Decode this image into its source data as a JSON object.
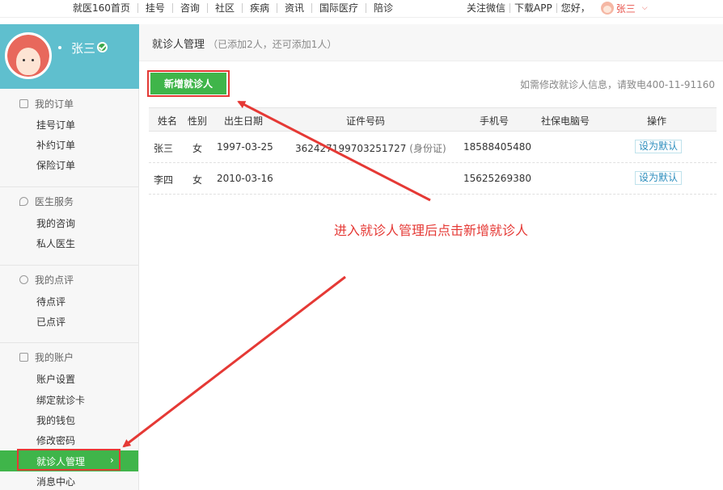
{
  "topnav": {
    "left_items": [
      "就医160首页",
      "挂号",
      "咨询",
      "社区",
      "疾病",
      "资讯",
      "国际医疗",
      "陪诊"
    ],
    "right_items": [
      "关注微信",
      "下载APP",
      "您好，"
    ],
    "user_name": "张三"
  },
  "sidebar": {
    "profile_name": "张三",
    "groups": [
      {
        "title": "我的订单",
        "links": [
          "挂号订单",
          "补约订单",
          "保险订单"
        ]
      },
      {
        "title": "医生服务",
        "links": [
          "我的咨询",
          "私人医生"
        ]
      },
      {
        "title": "我的点评",
        "links": [
          "待点评",
          "已点评"
        ]
      },
      {
        "title": "我的账户",
        "links": [
          "账户设置",
          "绑定就诊卡",
          "我的钱包",
          "修改密码"
        ]
      }
    ],
    "active_item": "就诊人管理",
    "below_active": "消息中心"
  },
  "main": {
    "title": "就诊人管理",
    "subtitle": "（已添加2人，还可添加1人）",
    "add_button": "新增就诊人",
    "hotline": "如需修改就诊人信息，请致电400-11-91160",
    "table": {
      "headers": [
        "姓名",
        "性别",
        "出生日期",
        "证件号码",
        "手机号",
        "社保电脑号",
        "操作"
      ],
      "rows": [
        {
          "name": "张三",
          "gender": "女",
          "birth": "1997-03-25",
          "id_number": "362427199703251727",
          "id_type": "(身份证)",
          "phone": "18588405480",
          "social": "",
          "action": "设为默认"
        },
        {
          "name": "李四",
          "gender": "女",
          "birth": "2010-03-16",
          "id_number": "",
          "id_type": "",
          "phone": "15625269380",
          "social": "",
          "action": "设为默认"
        }
      ]
    }
  },
  "annotation": {
    "text": "进入就诊人管理后点击新增就诊人",
    "color": "#e53935"
  },
  "colors": {
    "accent_green": "#3fb54a",
    "profile_bg": "#5fbfce",
    "link_blue": "#2b8dbd"
  }
}
